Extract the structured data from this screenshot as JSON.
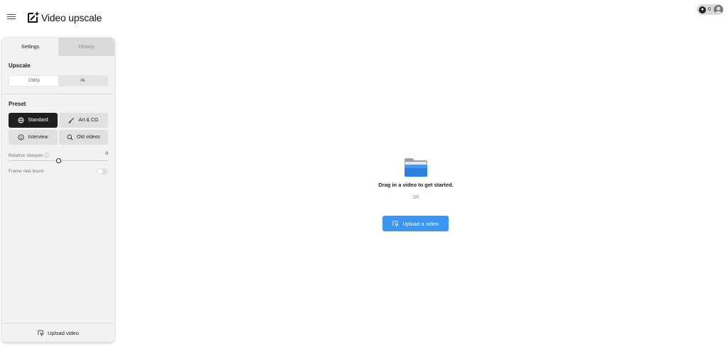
{
  "header": {
    "title": "Video upscale",
    "credits": "0",
    "menu_icon": "hamburger-icon",
    "logo_icon": "sparkle-edit-icon"
  },
  "panel": {
    "tabs": [
      {
        "label": "Settings",
        "active": true
      },
      {
        "label": "History",
        "active": false
      }
    ],
    "upscale": {
      "label": "Upscale",
      "options": [
        "1080p",
        "4k"
      ],
      "selected": "1080p"
    },
    "preset": {
      "label": "Preset",
      "options": [
        {
          "label": "Standard",
          "icon": "globe-icon",
          "selected": true
        },
        {
          "label": "Art & CG",
          "icon": "brush-icon",
          "selected": false
        },
        {
          "label": "Interview",
          "icon": "smiley-icon",
          "selected": false
        },
        {
          "label": "Old videos",
          "icon": "magnifier-icon",
          "selected": false
        }
      ]
    },
    "sharpen": {
      "label": "Relative sharpen ⓘ",
      "value": "0"
    },
    "frame_rate": {
      "label": "Frame rate boost",
      "enabled": false
    },
    "upload_label": "Upload video"
  },
  "main": {
    "prompt": "Drag in a video to get started.",
    "or": "OR",
    "upload_button": "Upload a video"
  },
  "colors": {
    "accent": "#3d95f0",
    "selected_preset": "#1f1f1f",
    "panel_bg": "#f2f2f2"
  }
}
